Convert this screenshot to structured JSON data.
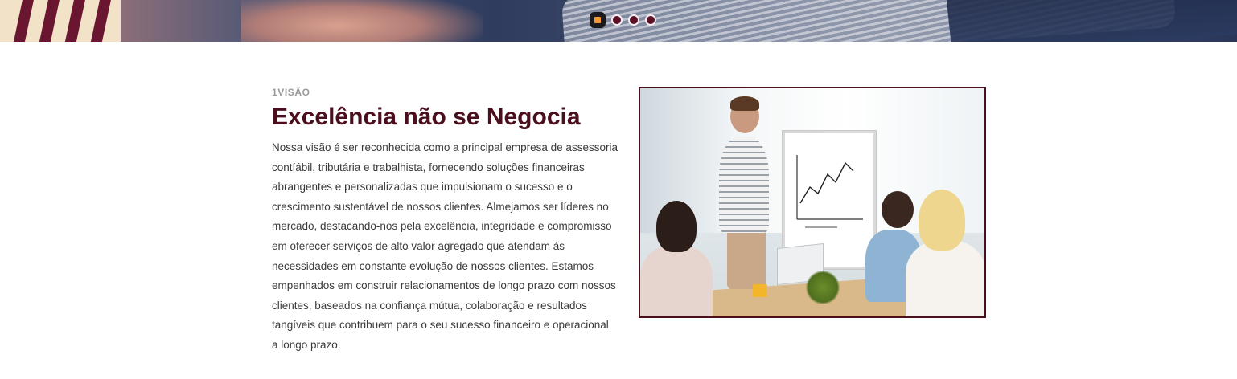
{
  "carousel": {
    "slides": [
      {
        "label": "slide-1",
        "active": true
      },
      {
        "label": "slide-2",
        "active": false
      },
      {
        "label": "slide-3",
        "active": false
      },
      {
        "label": "slide-4",
        "active": false
      }
    ]
  },
  "vision": {
    "eyebrow": "1VISÃO",
    "title": "Excelência não se Negocia",
    "body": "Nossa visão é ser reconhecida como a principal empresa de assessoria contíábil, tributária e trabalhista, fornecendo soluções financeiras abrangentes e personalizadas que impulsionam o sucesso e o crescimento sustentável de nossos clientes. Almejamos ser líderes no mercado, destacando-nos pela excelência, integridade e compromisso em oferecer serviços de alto valor agregado que atendam às necessidades em constante evolução de nossos clientes. Estamos empenhados em construir relacionamentos de longo prazo com nossos clientes, baseados na confiança mútua, colaboração e resultados tangíveis que contribuem para o seu sucesso financeiro e operacional a longo prazo."
  },
  "colors": {
    "brand": "#4a0f1d",
    "accent": "#f29a2e",
    "dot": "#5b0f26"
  }
}
